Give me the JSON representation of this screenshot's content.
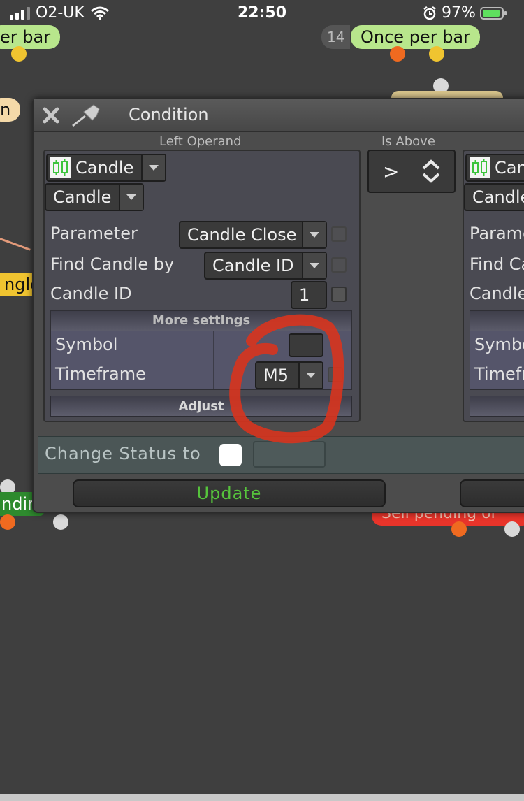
{
  "status_bar": {
    "carrier": "O2-UK",
    "time": "22:50",
    "battery": "97%"
  },
  "background_nodes": {
    "top_left_pill": "er bar",
    "top_right_number": "14",
    "top_right_pill": "Once per bar",
    "left_mid_pill": "n",
    "left_yellow_pill": "ngle",
    "left_green_pill": "ndir",
    "bottom_right_red_pill": "Sell pending or"
  },
  "dialog": {
    "title": "Condition",
    "left_operand": {
      "section_label": "Left Operand",
      "type_dropdown": "Candle",
      "subtype_dropdown": "Candle",
      "parameter_label": "Parameter",
      "parameter_value": "Candle Close",
      "find_by_label": "Find Candle by",
      "find_by_value": "Candle ID",
      "candle_id_label": "Candle ID",
      "candle_id_value": "1",
      "more_settings": "More settings",
      "symbol_label": "Symbol",
      "symbol_value": "",
      "timeframe_label": "Timeframe",
      "timeframe_value": "M5",
      "adjust": "Adjust"
    },
    "operator": {
      "section_label": "Is Above",
      "value": ">"
    },
    "right_operand": {
      "type_dropdown": "Can",
      "subtype_dropdown": "Candle",
      "parameter_label": "Parame",
      "find_by_label": "Find Ca",
      "candle_id_label": "Candle",
      "symbol_label": "Symbo",
      "timeframe_label": "Timefr"
    },
    "change_status_label": "Change Status to",
    "update_button": "Update"
  },
  "colors": {
    "annotation": "#d8341e",
    "update_text": "#56c43c",
    "candle_icon": "#3cc43c"
  },
  "icons": [
    "close-icon",
    "pin-icon",
    "candle-icon",
    "chevron-updown-icon",
    "dropdown-arrow-icon"
  ]
}
